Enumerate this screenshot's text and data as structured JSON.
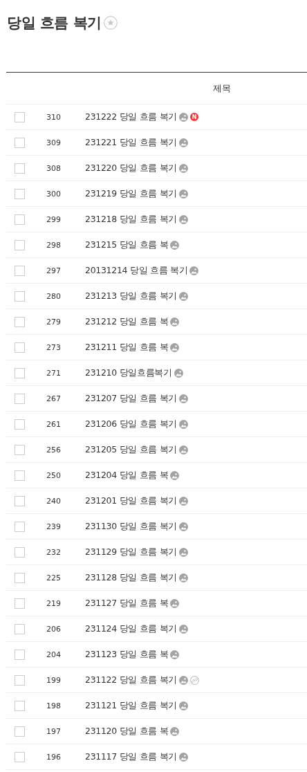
{
  "page_title": "당일 흐름 복기",
  "favorite": false,
  "table": {
    "columns": [
      "제목"
    ],
    "rows": [
      {
        "checked": false,
        "number": "310",
        "title": "231222 당일 흐름 복기",
        "badge": "N",
        "link": false
      },
      {
        "checked": false,
        "number": "309",
        "title": "231221 당일 흐름 복기",
        "link": false
      },
      {
        "checked": false,
        "number": "308",
        "title": "231220 당일 흐름 복기",
        "link": false
      },
      {
        "checked": false,
        "number": "300",
        "title": "231219 당일 흐름 복기",
        "link": false
      },
      {
        "checked": false,
        "number": "299",
        "title": "231218 당일 흐름 복기",
        "link": false
      },
      {
        "checked": false,
        "number": "298",
        "title": "231215 당일 흐름 복",
        "link": false
      },
      {
        "checked": false,
        "number": "297",
        "title": "20131214 당일 흐름 복기",
        "link": false
      },
      {
        "checked": false,
        "number": "280",
        "title": "231213 당일 흐름 복기",
        "link": false
      },
      {
        "checked": false,
        "number": "279",
        "title": "231212 당일 흐름 복",
        "link": false
      },
      {
        "checked": false,
        "number": "273",
        "title": "231211 당일 흐름 복",
        "link": false
      },
      {
        "checked": false,
        "number": "271",
        "title": "231210 당일흐름복기",
        "link": false
      },
      {
        "checked": false,
        "number": "267",
        "title": "231207 당일 흐름 복기",
        "link": false
      },
      {
        "checked": false,
        "number": "261",
        "title": "231206 당일 흐름 복기",
        "link": false
      },
      {
        "checked": false,
        "number": "256",
        "title": "231205 당일 흐름 복기",
        "link": false
      },
      {
        "checked": false,
        "number": "250",
        "title": "231204 당일 흐름 복",
        "link": false
      },
      {
        "checked": false,
        "number": "240",
        "title": "231201 당일 흐름 복기",
        "link": false
      },
      {
        "checked": false,
        "number": "239",
        "title": "231130 당일 흐름 복기",
        "link": false
      },
      {
        "checked": false,
        "number": "232",
        "title": "231129 당일 흐름 복기",
        "link": false
      },
      {
        "checked": false,
        "number": "225",
        "title": "231128 당일 흐름 복기",
        "link": false
      },
      {
        "checked": false,
        "number": "219",
        "title": "231127 당일 흐름 복",
        "link": false
      },
      {
        "checked": false,
        "number": "206",
        "title": "231124 당일 흐름 복기",
        "link": false
      },
      {
        "checked": false,
        "number": "204",
        "title": "231123 당일 흐름 복",
        "link": false
      },
      {
        "checked": false,
        "number": "199",
        "title": "231122 당일 흐름 복기",
        "link": true
      },
      {
        "checked": false,
        "number": "198",
        "title": "231121 당일 흐름 복기",
        "link": false
      },
      {
        "checked": false,
        "number": "197",
        "title": "231120 당일 흐름 복",
        "link": false
      },
      {
        "checked": false,
        "number": "196",
        "title": "231117 당일 흐름 복기",
        "link": false
      }
    ]
  }
}
